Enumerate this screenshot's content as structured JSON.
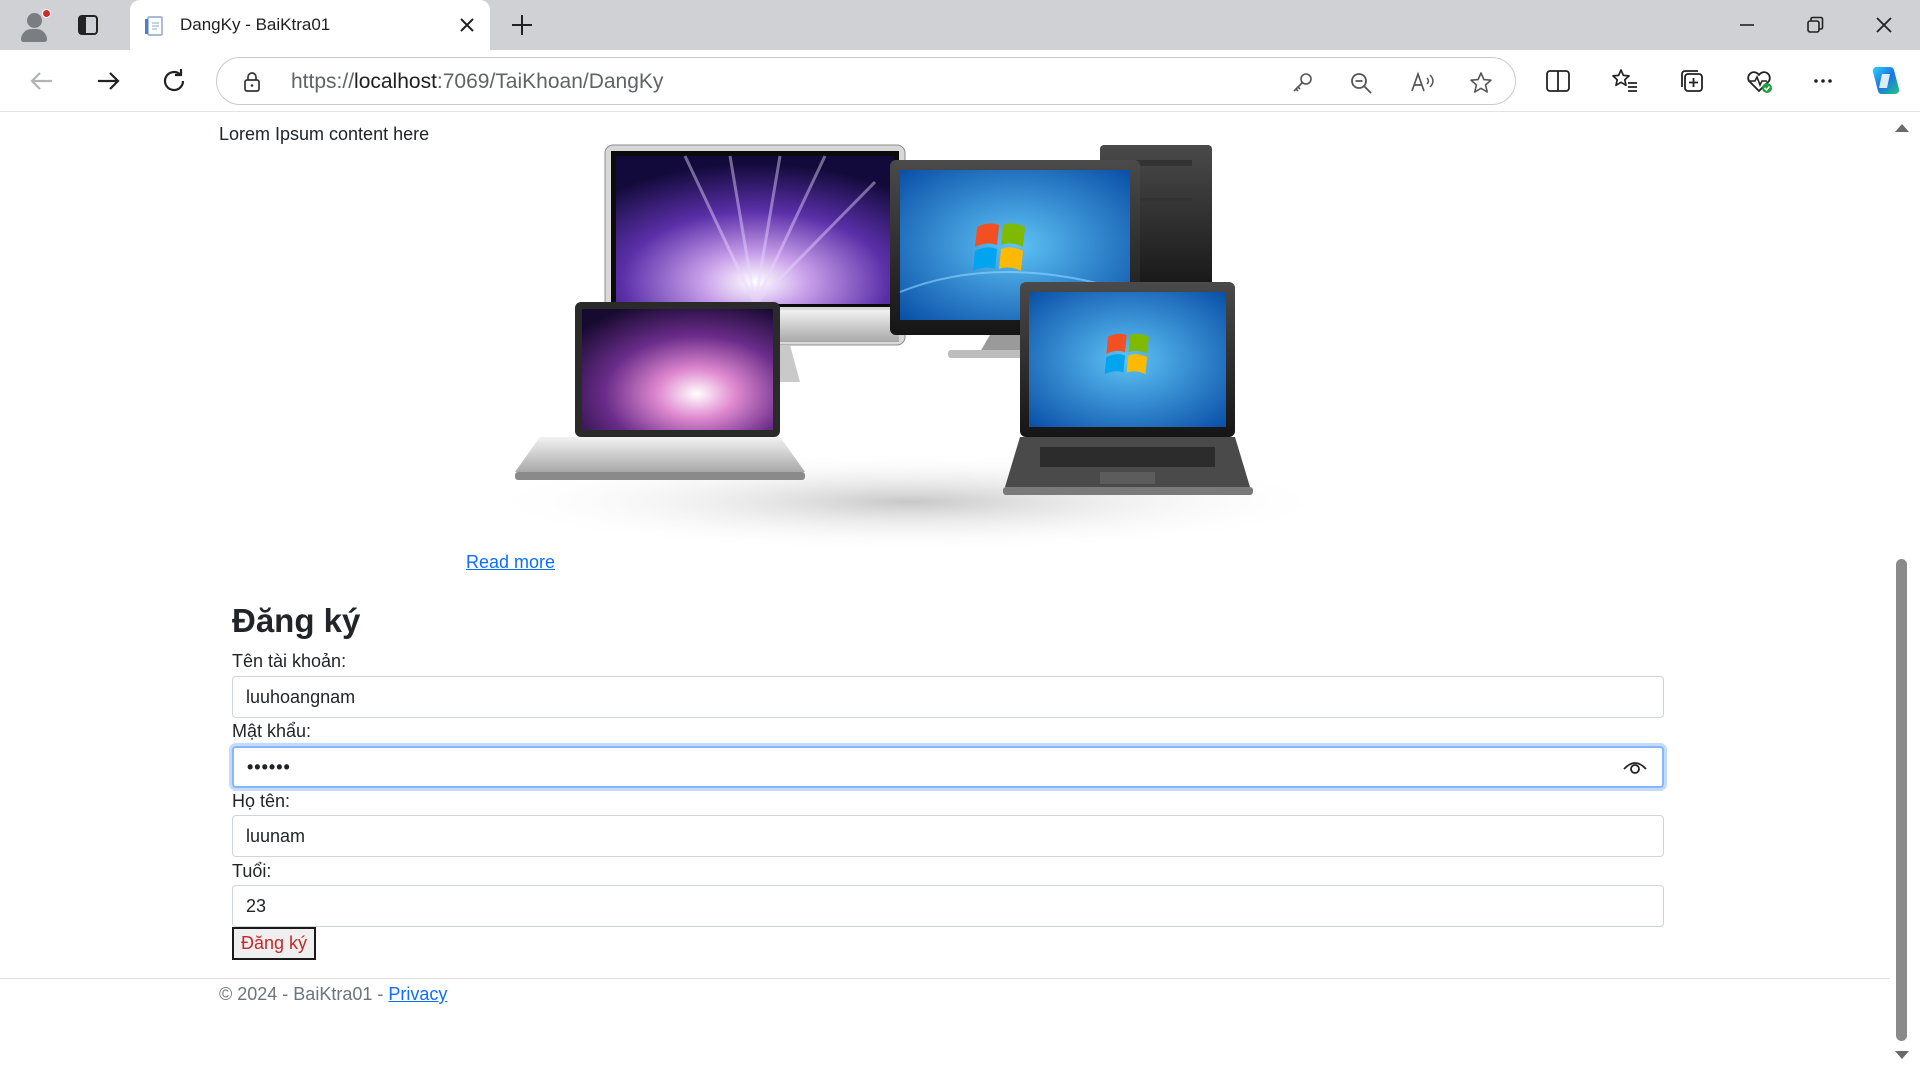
{
  "browser": {
    "tab_title": "DangKy - BaiKtra01",
    "url_prefix": "https://",
    "url_host": "localhost",
    "url_rest": ":7069/TaiKhoan/DangKy"
  },
  "page": {
    "lorem": "Lorem Ipsum content here",
    "read_more": "Read more",
    "form": {
      "title": "Đăng ký",
      "username_label": "Tên tài khoản:",
      "username_value": "luuhoangnam",
      "password_label": "Mật khẩu:",
      "password_value": "••••••",
      "fullname_label": "Họ tên:",
      "fullname_value": "luunam",
      "age_label": "Tuổi:",
      "age_value": "23",
      "submit_label": "Đăng ký"
    },
    "footer": {
      "copyright": "© 2024 - BaiKtra01 - ",
      "privacy": "Privacy"
    }
  },
  "colors": {
    "accent": "#0d6efd",
    "focus_ring": "#86b7fe",
    "submit_text": "#c62828"
  },
  "icons": [
    "profile-icon",
    "tab-actions-icon",
    "page-favicon-icon",
    "close-tab-icon",
    "new-tab-icon",
    "minimize-icon",
    "restore-icon",
    "close-window-icon",
    "back-icon",
    "forward-icon",
    "refresh-icon",
    "lock-icon",
    "password-key-icon",
    "zoom-out-icon",
    "read-aloud-icon",
    "favorite-star-icon",
    "split-screen-icon",
    "favorites-icon",
    "collections-icon",
    "browser-essentials-icon",
    "more-icon",
    "copilot-icon",
    "show-password-icon"
  ]
}
